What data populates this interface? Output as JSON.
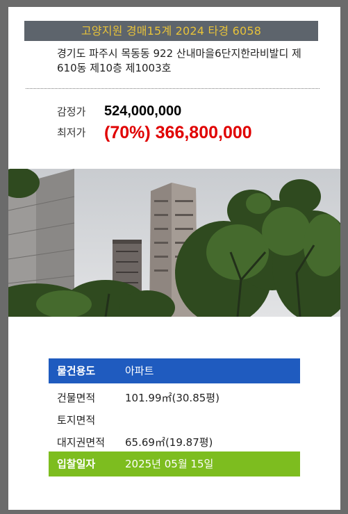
{
  "title": "고양지원 경매15계 2024 타경 6058",
  "address_line1": "경기도 파주시 목동동 922 산내마을6단지한라비발디 제",
  "address_line2": "610동 제10층 제1003호",
  "prices": {
    "appraisal_label": "감정가",
    "appraisal_value": "524,000,000",
    "minimum_label": "최저가",
    "minimum_value": "(70%) 366,800,000"
  },
  "photo": {
    "subject": "apartment-buildings-behind-trees"
  },
  "details": {
    "usage_label": "물건용도",
    "usage_value": "아파트",
    "building_area_label": "건물면적",
    "building_area_value": "101.99㎡(30.85평)",
    "land_area_label": "토지면적",
    "land_area_value": "",
    "land_right_area_label": "대지권면적",
    "land_right_area_value": "65.69㎡(19.87평)",
    "bid_date_label": "입찰일자",
    "bid_date_value": "2025년 05월 15일"
  },
  "colors": {
    "title_bg": "#5d646c",
    "title_text": "#e7c23a",
    "minimum_price": "#e00000",
    "usage_row_bg": "#1f5bbf",
    "bid_row_bg": "#7dbd1f"
  }
}
